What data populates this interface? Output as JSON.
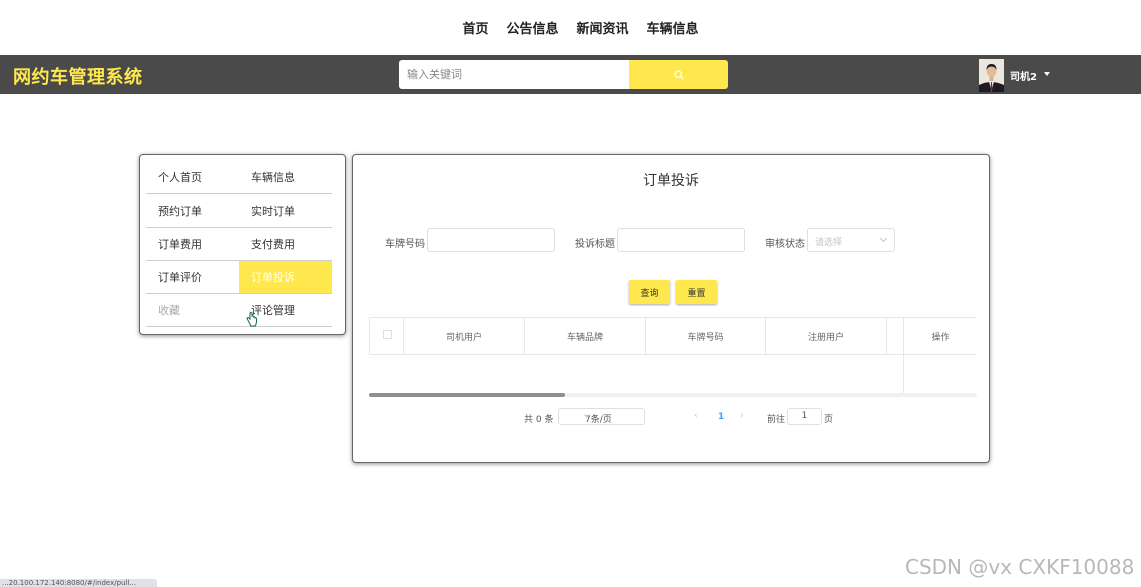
{
  "top_nav": [
    "首页",
    "公告信息",
    "新闻资讯",
    "车辆信息"
  ],
  "header": {
    "brand": "网约车管理系统",
    "search_placeholder": "输入关键词",
    "username": "司机2"
  },
  "sidebar": {
    "items": [
      {
        "label": "个人首页",
        "state": "normal"
      },
      {
        "label": "车辆信息",
        "state": "normal"
      },
      {
        "label": "预约订单",
        "state": "normal"
      },
      {
        "label": "实时订单",
        "state": "normal"
      },
      {
        "label": "订单费用",
        "state": "normal"
      },
      {
        "label": "支付费用",
        "state": "normal"
      },
      {
        "label": "订单评价",
        "state": "normal"
      },
      {
        "label": "订单投诉",
        "state": "active"
      },
      {
        "label": "收藏",
        "state": "muted"
      },
      {
        "label": "评论管理",
        "state": "normal"
      }
    ]
  },
  "main": {
    "title": "订单投诉",
    "filters": {
      "plate_label": "车牌号码",
      "complaint_title_label": "投诉标题",
      "review_status_label": "审核状态",
      "review_status_placeholder": "请选择"
    },
    "buttons": {
      "query": "查询",
      "reset": "重置"
    },
    "table": {
      "columns": [
        "司机用户",
        "车辆品牌",
        "车牌号码",
        "注册用户",
        "操作"
      ],
      "rows": []
    },
    "pagination": {
      "total_text": "共 0 条",
      "page_size": "7条/页",
      "prev_symbol": "‹",
      "current_page": "1",
      "next_symbol": "›",
      "goto_label": "前往",
      "goto_value": "1",
      "page_unit": "页"
    }
  },
  "watermark": "CSDN @vx  CXKF10088",
  "statusbar": "...20.100.172.140:8080/#/index/pull...",
  "colors": {
    "accent": "#ffe84d",
    "header_bg": "#4a4a4a",
    "pager_active": "#409eff"
  }
}
